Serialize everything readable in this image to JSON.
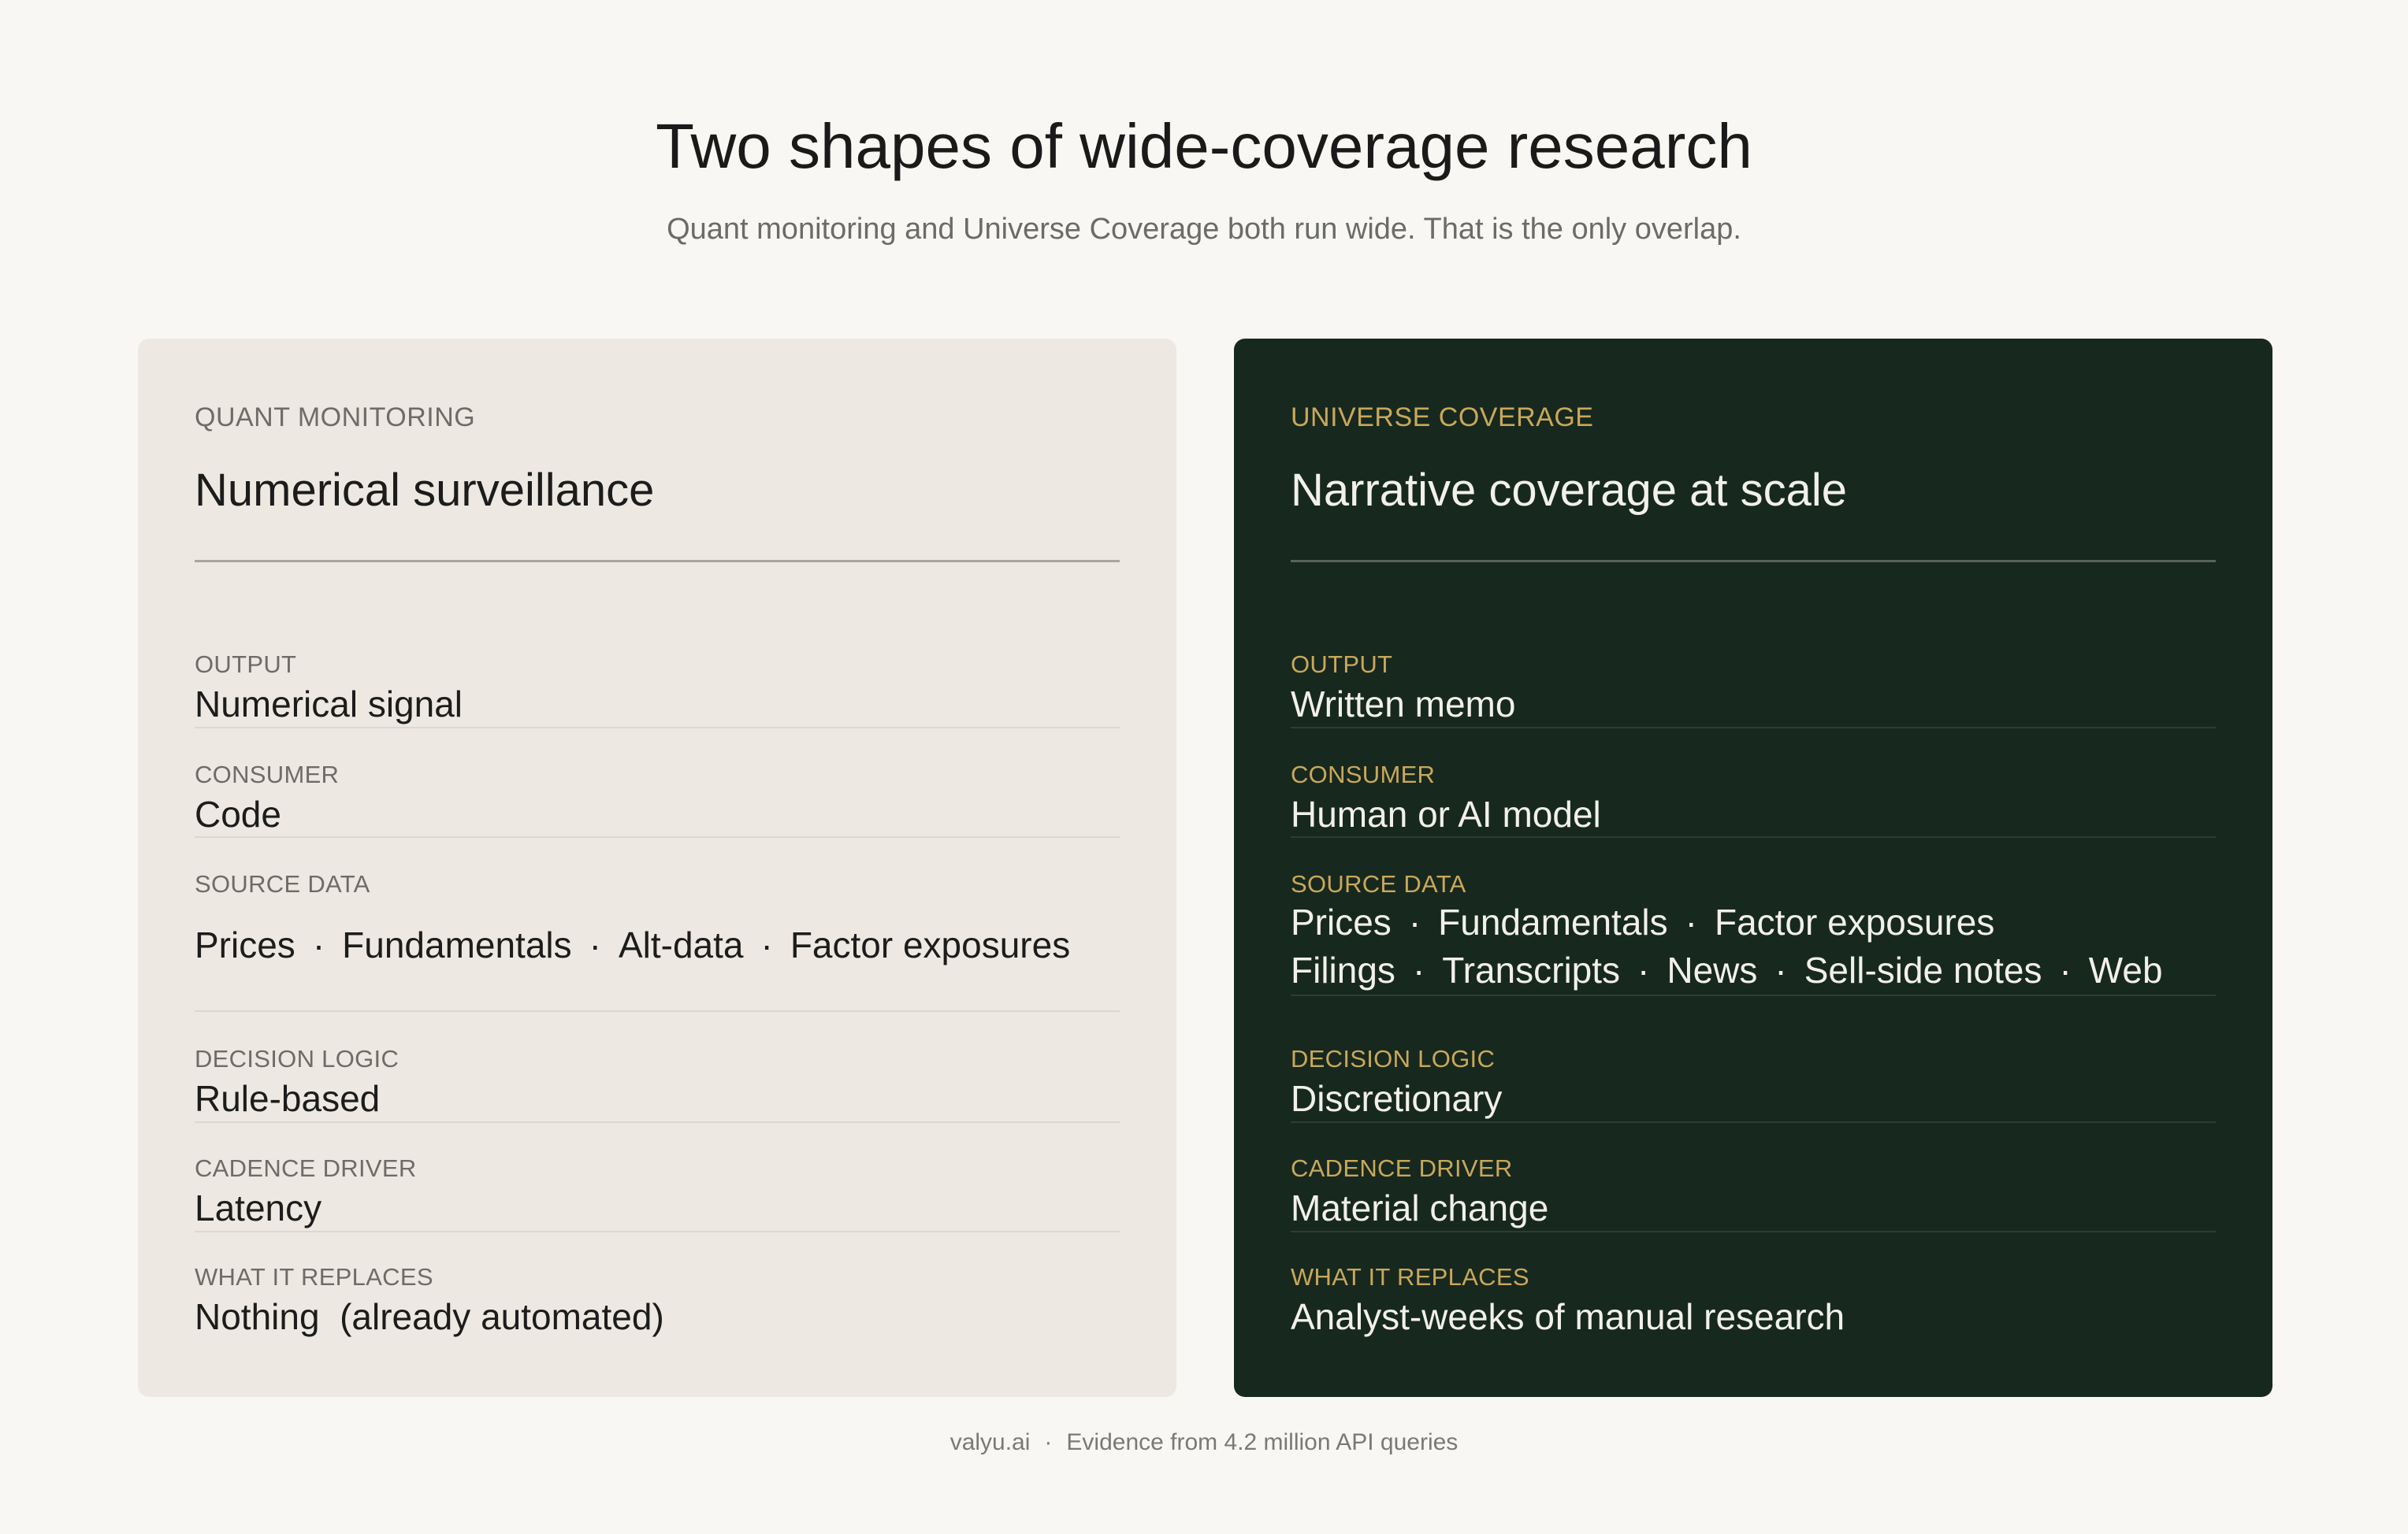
{
  "header": {
    "title": "Two shapes of wide-coverage research",
    "subtitle": "Quant monitoring and Universe Coverage both run wide. That is the only overlap."
  },
  "cards": [
    {
      "eyebrow": "QUANT MONITORING",
      "heading": "Numerical surveillance",
      "rows": [
        {
          "label": "OUTPUT",
          "value": "Numerical signal"
        },
        {
          "label": "CONSUMER",
          "value": "Code"
        },
        {
          "label": "SOURCE DATA",
          "items": [
            "Prices",
            "Fundamentals",
            "Alt-data",
            "Factor exposures"
          ]
        },
        {
          "label": "DECISION LOGIC",
          "value": "Rule-based"
        },
        {
          "label": "CADENCE DRIVER",
          "value": "Latency"
        },
        {
          "label": "WHAT IT REPLACES",
          "value": "Nothing  (already automated)"
        }
      ]
    },
    {
      "eyebrow": "UNIVERSE COVERAGE",
      "heading": "Narrative coverage at scale",
      "rows": [
        {
          "label": "OUTPUT",
          "value": "Written memo"
        },
        {
          "label": "CONSUMER",
          "value": "Human or AI model"
        },
        {
          "label": "SOURCE DATA",
          "items_line1": [
            "Prices",
            "Fundamentals",
            "Factor exposures"
          ],
          "items_line2": [
            "Filings",
            "Transcripts",
            "News",
            "Sell-side notes",
            "Web"
          ]
        },
        {
          "label": "DECISION LOGIC",
          "value": "Discretionary"
        },
        {
          "label": "CADENCE DRIVER",
          "value": "Material change"
        },
        {
          "label": "WHAT IT REPLACES",
          "value": "Analyst-weeks of manual research"
        }
      ]
    }
  ],
  "footer": {
    "brand": "valyu.ai",
    "separator": "·",
    "note": "Evidence from 4.2 million API queries"
  },
  "list_separator": "·"
}
